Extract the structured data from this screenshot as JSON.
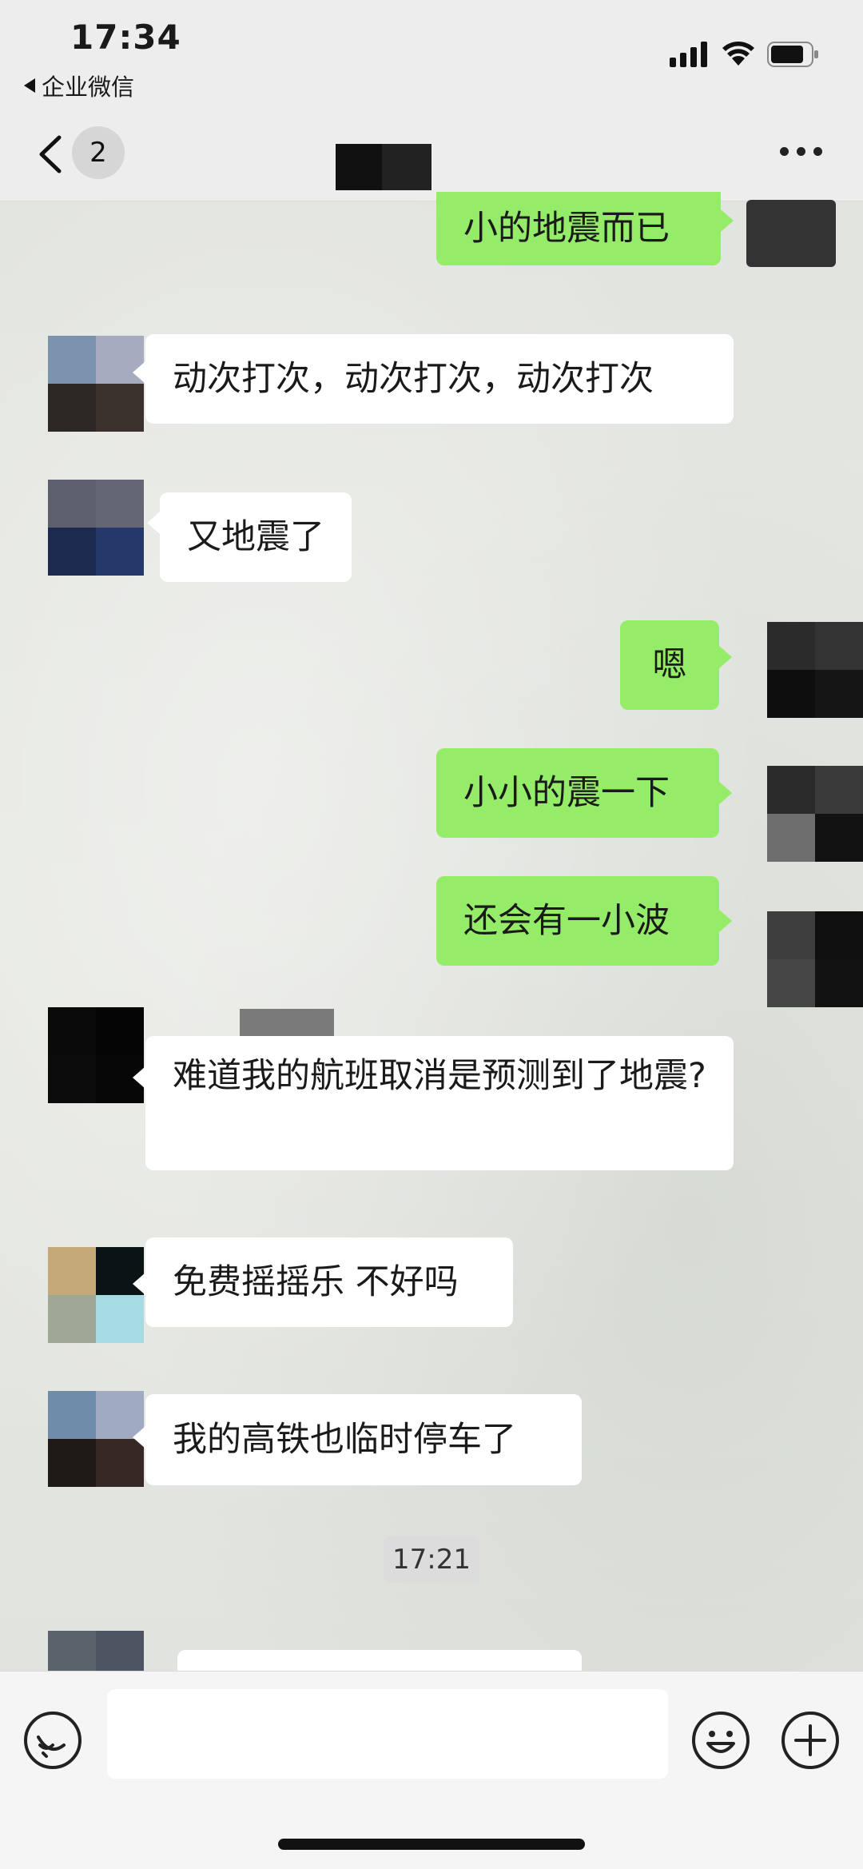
{
  "status_bar": {
    "time": "17:34",
    "back_app_label": "企业微信"
  },
  "nav": {
    "unread_count": "2",
    "title_redacted": true
  },
  "messages": [
    {
      "side": "out",
      "text": "小的地震而已"
    },
    {
      "side": "in",
      "text": "动次打次，动次打次，动次打次"
    },
    {
      "side": "in",
      "text": "又地震了"
    },
    {
      "side": "out",
      "text": "嗯"
    },
    {
      "side": "out",
      "text": "小小的震一下"
    },
    {
      "side": "out",
      "text": "还会有一小波"
    },
    {
      "side": "in",
      "text": "难道我的航班取消是预测到了地震?"
    },
    {
      "side": "in",
      "text": "免费摇摇乐 不好吗"
    },
    {
      "side": "in",
      "text": "我的高铁也临时停车了"
    }
  ],
  "timestamp": "17:21",
  "input": {
    "placeholder": "",
    "value": ""
  },
  "colors": {
    "outgoing_bubble": "#95ec69",
    "incoming_bubble": "#ffffff",
    "chrome_bg": "#ededed"
  },
  "icons": {
    "status": [
      "cellular-signal-icon",
      "wifi-icon",
      "battery-icon"
    ],
    "nav": [
      "back-chevron-icon",
      "more-dots-icon"
    ],
    "input": [
      "voice-icon",
      "emoji-icon",
      "plus-icon"
    ]
  }
}
